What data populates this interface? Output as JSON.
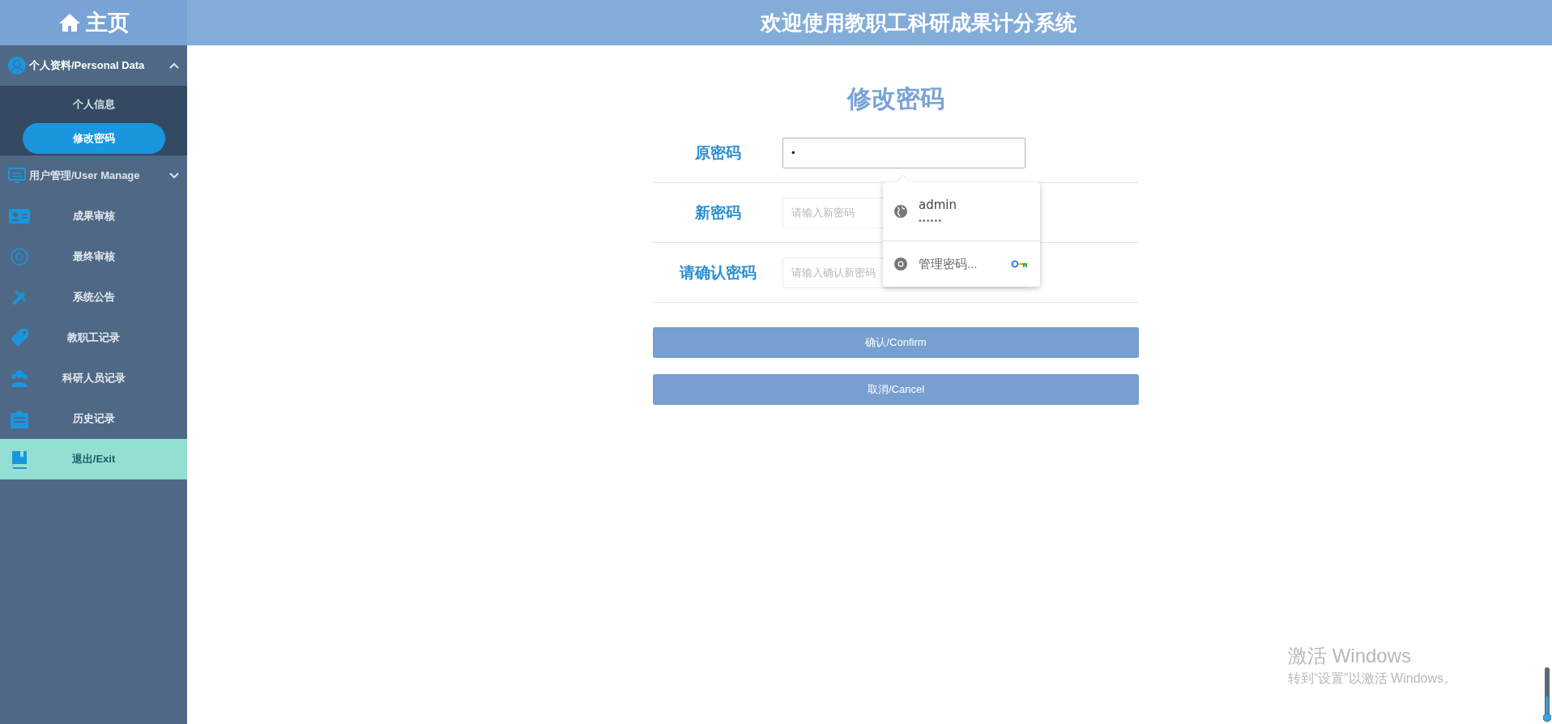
{
  "sidebar": {
    "home": {
      "label": "主页"
    },
    "groups": [
      {
        "label": "个人资料/Personal Data",
        "expanded": true,
        "children": [
          {
            "label": "个人信息",
            "selected": false
          },
          {
            "label": "修改密码",
            "selected": true
          }
        ]
      },
      {
        "label": "用户管理/User Manage",
        "expanded": false
      }
    ],
    "items": [
      {
        "label": "成果审核",
        "highlighted": false
      },
      {
        "label": "最终审核",
        "highlighted": false
      },
      {
        "label": "系统公告",
        "highlighted": false
      },
      {
        "label": "教职工记录",
        "highlighted": false
      },
      {
        "label": "科研人员记录",
        "highlighted": false
      },
      {
        "label": "历史记录",
        "highlighted": false
      },
      {
        "label": "退出/Exit",
        "highlighted": true
      }
    ]
  },
  "header": {
    "title": "欢迎使用教职工科研成果计分系统"
  },
  "form": {
    "title": "修改密码",
    "fields": [
      {
        "label": "原密码",
        "value": "•",
        "focused": true
      },
      {
        "label": "新密码",
        "placeholder": "请输入新密码",
        "focused": false
      },
      {
        "label": "请确认密码",
        "placeholder": "请输入确认新密码",
        "focused": false
      }
    ],
    "buttons": [
      "确认/Confirm",
      "取消/Cancel"
    ]
  },
  "autofill_popup": {
    "entries": [
      {
        "kind": "credential",
        "username": "admin",
        "password": "••••••"
      },
      {
        "kind": "manage",
        "label": "管理密码..."
      }
    ]
  },
  "activation_notice": {
    "title": "激活 Windows",
    "subtitle": "转到“设置”以激活 Windows。"
  }
}
